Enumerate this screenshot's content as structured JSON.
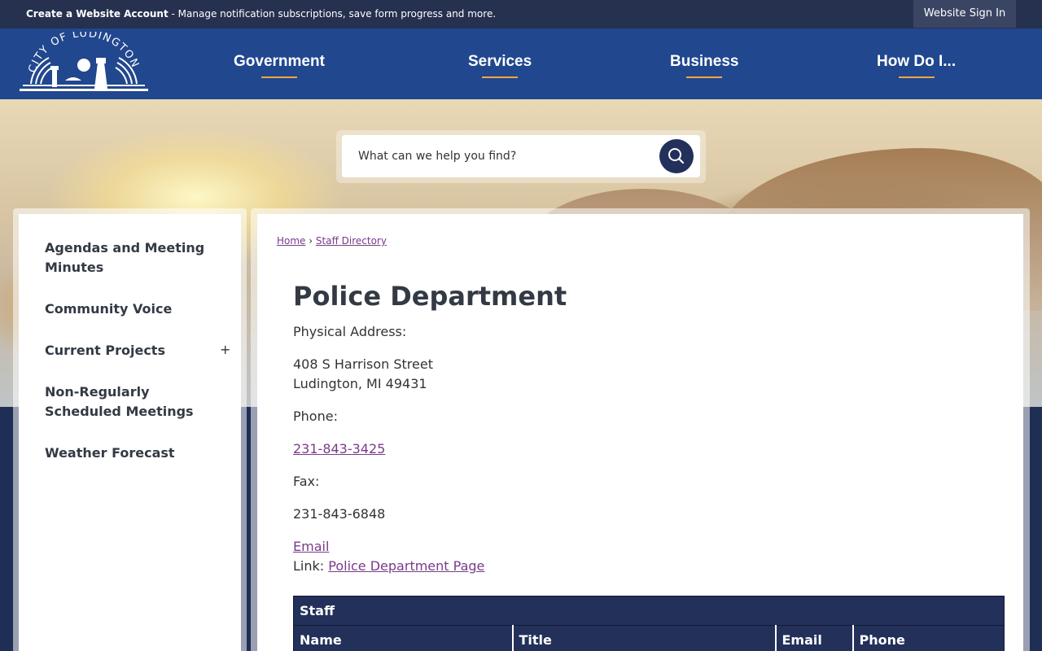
{
  "topbar": {
    "create_account_label": "Create a Website Account",
    "create_account_desc": " - Manage notification subscriptions, save form progress and more.",
    "sign_in_label": "Website Sign In"
  },
  "logo": {
    "text": "CITY OF LUDINGTON"
  },
  "nav": [
    {
      "label": "Government"
    },
    {
      "label": "Services"
    },
    {
      "label": "Business"
    },
    {
      "label": "How Do I..."
    }
  ],
  "search": {
    "placeholder": "What can we help you find?"
  },
  "sidebar": {
    "items": [
      {
        "label": "Agendas and Meeting Minutes"
      },
      {
        "label": "Community Voice"
      },
      {
        "label": "Current Projects",
        "toggle": "+"
      },
      {
        "label": "Non-Regularly Scheduled Meetings"
      },
      {
        "label": "Weather Forecast"
      }
    ]
  },
  "breadcrumb": {
    "home": "Home",
    "separator": "›",
    "current": "Staff Directory"
  },
  "department": {
    "title": "Police Department",
    "address_label": "Physical Address:",
    "address_line1": "408 S Harrison Street",
    "address_line2": "Ludington, MI 49431",
    "phone_label": "Phone:",
    "phone": "231-843-3425",
    "fax_label": "Fax:",
    "fax": "231-843-6848",
    "email_label": "Email",
    "link_prefix": "Link: ",
    "link_label": "Police Department Page"
  },
  "staff_table": {
    "caption": "Staff",
    "columns": [
      "Name",
      "Title",
      "Email",
      "Phone"
    ]
  },
  "colors": {
    "topbar": "#25314f",
    "header": "#21478e",
    "accent_underline": "#f2a742",
    "link": "#7a3a8a",
    "table_header": "#22305a"
  }
}
